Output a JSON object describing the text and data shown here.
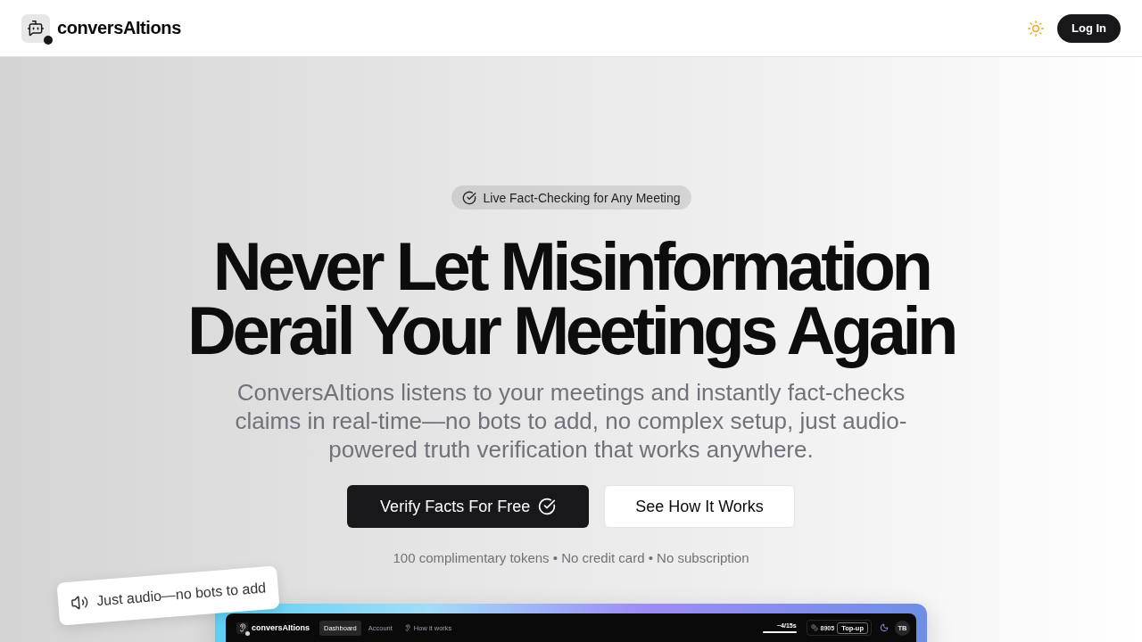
{
  "header": {
    "brand": "conversAItions",
    "login_button": "Log In"
  },
  "hero": {
    "badge": "Live Fact-Checking for Any Meeting",
    "title_lines": [
      "Never Let Misinformation",
      "Derail Your Meetings Again"
    ],
    "subtitle": "ConversAItions listens to your meetings and instantly fact-checks claims in real-time—no bots to add, no complex setup, just audio-powered truth verification that works anywhere.",
    "buttons": [
      {
        "label": "Verify Facts For Free",
        "kind": "primary"
      },
      {
        "label": "See How It Works",
        "kind": "secondary"
      }
    ],
    "note": "100 complimentary tokens • No credit card • No subscription"
  },
  "floating_tag": {
    "text": "Just audio—no bots to add"
  },
  "preview": {
    "brand": "conversAItions",
    "tabs": [
      {
        "label": "Dashboard",
        "selected": true,
        "kind": "plain"
      },
      {
        "label": "Account",
        "selected": false,
        "kind": "plain"
      },
      {
        "label": "How it works",
        "selected": false,
        "kind": "with-icon"
      }
    ],
    "usage": {
      "reading": "~4/15s",
      "level": 1
    },
    "tokens": "8905",
    "topup_button": "Top-up",
    "avatar": "TB"
  }
}
